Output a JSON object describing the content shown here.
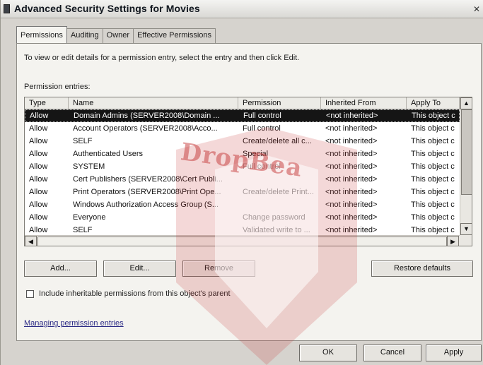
{
  "window": {
    "title": "Advanced Security Settings for Movies",
    "close_glyph": "✕"
  },
  "tabs": [
    {
      "label": "Permissions"
    },
    {
      "label": "Auditing"
    },
    {
      "label": "Owner"
    },
    {
      "label": "Effective Permissions"
    }
  ],
  "instructions": "To view or edit details for a permission entry, select the entry and then click Edit.",
  "permission_entries": {
    "label": "Permission entries:",
    "columns": [
      "Type",
      "Name",
      "Permission",
      "Inherited From",
      "Apply To"
    ],
    "rows": [
      {
        "type": "Allow",
        "name": "Domain Admins (SERVER2008\\Domain ...",
        "permission": "Full control",
        "inherited": "<not inherited>",
        "apply": "This object c",
        "selected": true
      },
      {
        "type": "Allow",
        "name": "Account Operators (SERVER2008\\Acco...",
        "permission": "Full control",
        "inherited": "<not inherited>",
        "apply": "This object c"
      },
      {
        "type": "Allow",
        "name": "SELF",
        "permission": "Create/delete all c...",
        "inherited": "<not inherited>",
        "apply": "This object c"
      },
      {
        "type": "Allow",
        "name": "Authenticated Users",
        "permission": "Special",
        "inherited": "<not inherited>",
        "apply": "This object c"
      },
      {
        "type": "Allow",
        "name": "SYSTEM",
        "permission": "Full control",
        "inherited": "<not inherited>",
        "apply": "This object c"
      },
      {
        "type": "Allow",
        "name": "Cert Publishers (SERVER2008\\Cert Publi...",
        "permission": "",
        "inherited": "<not inherited>",
        "apply": "This object c"
      },
      {
        "type": "Allow",
        "name": "Print Operators (SERVER2008\\Print Ope...",
        "permission": "Create/delete Print...",
        "inherited": "<not inherited>",
        "apply": "This object c"
      },
      {
        "type": "Allow",
        "name": "Windows Authorization Access Group (S...",
        "permission": "",
        "inherited": "<not inherited>",
        "apply": "This object c"
      },
      {
        "type": "Allow",
        "name": "Everyone",
        "permission": "Change password",
        "inherited": "<not inherited>",
        "apply": "This object c"
      },
      {
        "type": "Allow",
        "name": "SELF",
        "permission": "Validated write to ...",
        "inherited": "<not inherited>",
        "apply": "This object c"
      }
    ],
    "scroll_up": "▲",
    "scroll_down": "▼",
    "scroll_left": "◀",
    "scroll_right": "▶"
  },
  "buttons": {
    "add": "Add...",
    "edit": "Edit...",
    "remove": "Remove",
    "restore": "Restore defaults",
    "ok": "OK",
    "cancel": "Cancel",
    "apply": "Apply"
  },
  "checkbox": {
    "label": "Include inheritable permissions from this object's parent",
    "checked": false
  },
  "link": {
    "label": "Managing permission entries"
  },
  "watermark": {
    "text": "DropBea"
  },
  "colors": {
    "selection": "#151515",
    "link": "#2c2b86",
    "watermark": "#c63a3a"
  }
}
